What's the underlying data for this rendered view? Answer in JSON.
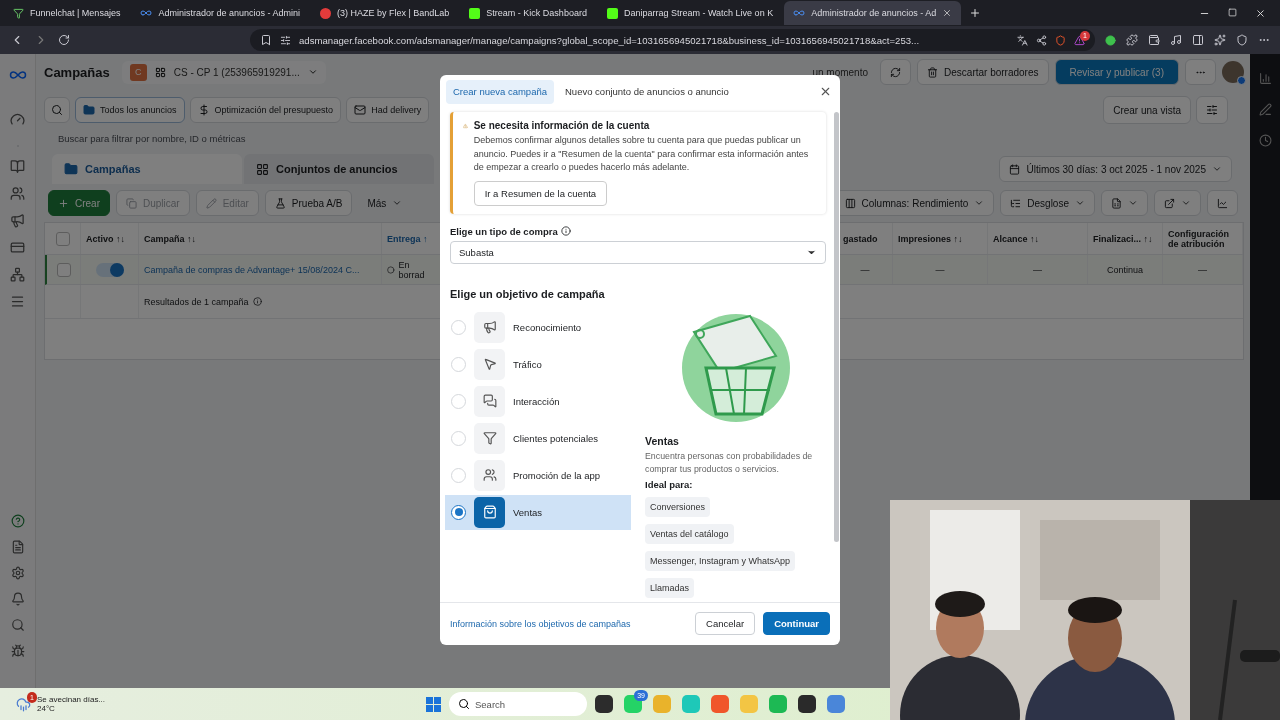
{
  "browser": {
    "tabs": [
      {
        "kind": "funnel",
        "title": "Funnelchat | Mensajes",
        "selected": false
      },
      {
        "kind": "meta",
        "title": "Administrador de anuncios - Admini",
        "selected": false
      },
      {
        "kind": "bandlab",
        "title": "(3) HAZE by Flex | BandLab",
        "selected": false
      },
      {
        "kind": "kick",
        "title": "Stream - Kick Dashboard",
        "selected": false
      },
      {
        "kind": "kick",
        "title": "Daniparrag Stream - Watch Live on K",
        "selected": false
      },
      {
        "kind": "meta",
        "title": "Administrador de anuncios - Ad",
        "selected": true
      }
    ],
    "url": "adsmanager.facebook.com/adsmanager/manage/campaigns?global_scope_id=1031656945021718&business_id=1031656945021718&act=253...",
    "extension_badge": "1"
  },
  "header": {
    "title": "Campañas",
    "account_badge": "C",
    "account": "CS - CP 1 (253965919291...",
    "status": "un momento",
    "discard": "Descartar borradores",
    "publish": "Revisar y publicar (3)"
  },
  "filters": {
    "items": [
      {
        "kind": "folder",
        "label": "Todos los anuncios",
        "selected": true
      },
      {
        "kind": "budget",
        "label": "Optimización del presupuesto",
        "selected": false
      },
      {
        "kind": "delivery",
        "label": "Had delivery",
        "selected": false
      }
    ],
    "view_button": "Crear una vista"
  },
  "search": {
    "placeholder": "Buscar para filtrar por nombre, ID o métricas"
  },
  "level_tabs": [
    {
      "kind": "campaigns",
      "label": "Campañas",
      "selected": true
    },
    {
      "kind": "adsets",
      "label": "Conjuntos de anuncios",
      "selected": false
    }
  ],
  "date_range": "Últimos 30 días: 3 oct 2025 - 1 nov 2025",
  "toolbar": {
    "left": [
      {
        "kind": "create",
        "label": "Crear",
        "disabled": false
      },
      {
        "kind": "duplicate",
        "label": "Duplicar",
        "disabled": true
      },
      {
        "kind": "edit",
        "label": "Editar",
        "disabled": true
      },
      {
        "kind": "test",
        "label": "Prueba A/B",
        "disabled": false
      },
      {
        "kind": "more",
        "label": "Más",
        "disabled": false
      }
    ],
    "columns": "Columnas: Rendimiento",
    "breakdown": "Desglose"
  },
  "table": {
    "select_all_checked": false,
    "left_columns": [
      "Activo ↑↓",
      "Campaña ↑↓",
      "Entrega ↑"
    ],
    "right_columns": [
      "gastado",
      "Impresiones ↑↓",
      "Alcance ↑↓",
      "Finalizaci... ↑↓",
      "Configuración de atribución"
    ],
    "rows": [
      {
        "checked": false,
        "on": true,
        "name": "Campaña de compras de Advantage+ 15/08/2024 C...",
        "delivery": "En borrad",
        "cells": [
          "—",
          "—",
          "—",
          "Continua",
          "—"
        ]
      }
    ],
    "footer": "Resultados de 1 campaña"
  },
  "modal": {
    "tabs": [
      {
        "label": "Crear nueva campaña",
        "selected": true
      },
      {
        "label": "Nuevo conjunto de anuncios o anuncio",
        "selected": false
      }
    ],
    "warning": {
      "title": "Se necesita información de la cuenta",
      "text": "Debemos confirmar algunos detalles sobre tu cuenta para que puedas publicar un anuncio. Puedes ir a \"Resumen de la cuenta\" para confirmar esta información antes de empezar a crearlo o puedes hacerlo más adelante.",
      "button": "Ir a Resumen de la cuenta"
    },
    "buying_label": "Elige un tipo de compra",
    "buying_value": "Subasta",
    "objective_heading": "Elige un objetivo de campaña",
    "objectives": [
      {
        "kind": "awareness",
        "label": "Reconocimiento",
        "selected": false
      },
      {
        "kind": "traffic",
        "label": "Tráfico",
        "selected": false
      },
      {
        "kind": "engagement",
        "label": "Interacción",
        "selected": false
      },
      {
        "kind": "leads",
        "label": "Clientes potenciales",
        "selected": false
      },
      {
        "kind": "app",
        "label": "Promoción de la app",
        "selected": false
      },
      {
        "kind": "sales",
        "label": "Ventas",
        "selected": true
      }
    ],
    "detail": {
      "title": "Ventas",
      "text": "Encuentra personas con probabilidades de comprar tus productos o servicios.",
      "ideal_label": "Ideal para:",
      "tags": [
        "Conversiones",
        "Ventas del catálogo",
        "Messenger, Instagram y WhatsApp",
        "Llamadas"
      ]
    },
    "info_link": "Información sobre los objetivos de campañas",
    "cancel": "Cancelar",
    "continue": "Continuar"
  },
  "taskbar": {
    "weather": {
      "text": "Se avecinan días...",
      "temp": "24°C",
      "badge": "1"
    },
    "search": {
      "placeholder": "Search"
    },
    "apps": [
      {
        "kind": "widget"
      },
      {
        "kind": "whatsapp",
        "badge": "39"
      },
      {
        "kind": "chrome"
      },
      {
        "kind": "app"
      },
      {
        "kind": "brave"
      },
      {
        "kind": "folder"
      },
      {
        "kind": "spotify"
      },
      {
        "kind": "obs"
      },
      {
        "kind": "notepad"
      }
    ]
  }
}
